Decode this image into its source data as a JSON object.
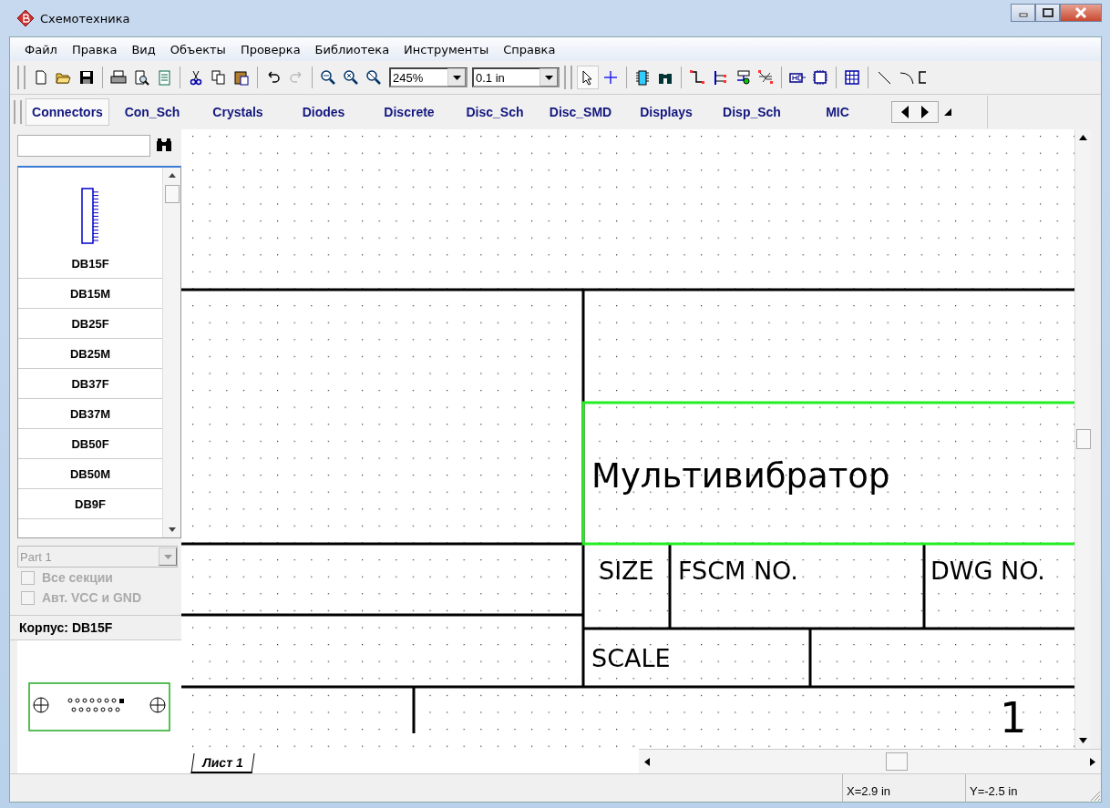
{
  "window": {
    "title": "Схемотехника"
  },
  "menu": [
    "Файл",
    "Правка",
    "Вид",
    "Объекты",
    "Проверка",
    "Библиотека",
    "Инструменты",
    "Справка"
  ],
  "toolbar": {
    "zoom": "245%",
    "grid": "0.1 in",
    "redo_disabled": true,
    "pointer_selected": true
  },
  "library_tabs": [
    {
      "label": "Connectors",
      "selected": true
    },
    {
      "label": "Con_Sch",
      "selected": false
    },
    {
      "label": "Crystals",
      "selected": false
    },
    {
      "label": "Diodes",
      "selected": false
    },
    {
      "label": "Discrete",
      "selected": false
    },
    {
      "label": "Disc_Sch",
      "selected": false
    },
    {
      "label": "Disc_SMD",
      "selected": false
    },
    {
      "label": "Displays",
      "selected": false
    },
    {
      "label": "Disp_Sch",
      "selected": false
    },
    {
      "label": "MIC",
      "selected": false
    }
  ],
  "components": [
    {
      "label": "DB15F",
      "selected": true
    },
    {
      "label": "DB15M",
      "selected": false
    },
    {
      "label": "DB25F",
      "selected": false
    },
    {
      "label": "DB25M",
      "selected": false
    },
    {
      "label": "DB37F",
      "selected": false
    },
    {
      "label": "DB37M",
      "selected": false
    },
    {
      "label": "DB50F",
      "selected": false
    },
    {
      "label": "DB50M",
      "selected": false
    },
    {
      "label": "DB9F",
      "selected": false
    }
  ],
  "part_select": {
    "value": "Part 1",
    "disabled": true
  },
  "options": [
    {
      "label": "Все секции",
      "checked": false,
      "disabled": true
    },
    {
      "label": "Авт. VCC и GND",
      "checked": false,
      "disabled": true
    }
  ],
  "package_label": "Корпус: DB15F",
  "drawing": {
    "title": "Мультивибратор",
    "size_label": "SIZE",
    "fscm_label": "FSCM  NO.",
    "dwg_label": "DWG  NO.",
    "scale_label": "SCALE",
    "sheet_number": "1",
    "title_selected": true
  },
  "sheet_tabs": [
    {
      "label": "Лист 1",
      "selected": true
    }
  ],
  "status_bar": {
    "x": "X=2.9 in",
    "y": "Y=-2.5 in"
  }
}
